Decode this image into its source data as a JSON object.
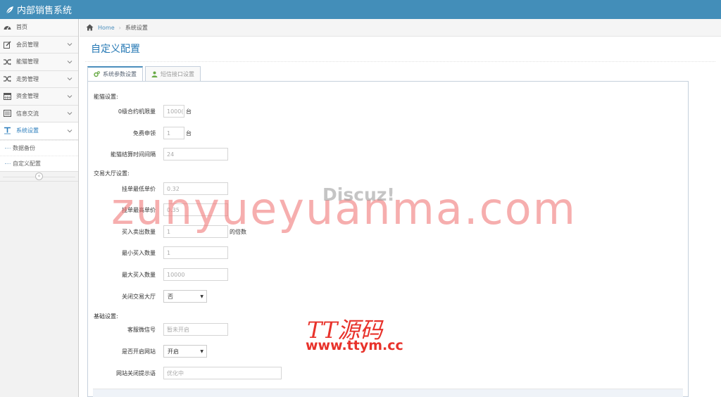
{
  "app": {
    "title": "内部销售系统"
  },
  "sidebar": {
    "items": [
      {
        "label": "首页",
        "icon": "tachometer-icon"
      },
      {
        "label": "会员管理",
        "icon": "edit-icon"
      },
      {
        "label": "能猫管理",
        "icon": "random-icon"
      },
      {
        "label": "走势管理",
        "icon": "random-icon"
      },
      {
        "label": "资金管理",
        "icon": "calendar-icon"
      },
      {
        "label": "信息交流",
        "icon": "list-icon"
      },
      {
        "label": "系统设置",
        "icon": "text-width-icon"
      }
    ],
    "sub_items": [
      {
        "label": "数据备份"
      },
      {
        "label": "自定义配置"
      }
    ],
    "collapse_symbol": "«"
  },
  "breadcrumb": {
    "home": "Home",
    "separator": "›",
    "current": "系统设置"
  },
  "page": {
    "title": "自定义配置"
  },
  "tabs": [
    {
      "label": "系统参数设置",
      "active": true
    },
    {
      "label": "短信接口设置",
      "active": false
    }
  ],
  "form": {
    "sections": [
      {
        "title": "能猫设置:",
        "fields": [
          {
            "label": "0级合约机限量",
            "value": "1000(",
            "suffix": "台"
          },
          {
            "label": "免费申领",
            "value": "1",
            "suffix": "台"
          },
          {
            "label": "能猫结算时间间隔",
            "value": "24",
            "suffix": ""
          }
        ]
      },
      {
        "title": "交易大厅设置:",
        "fields": [
          {
            "label": "挂单最低单价",
            "value": "0.32",
            "suffix": ""
          },
          {
            "label": "挂单最高单价",
            "value": "0.35",
            "suffix": ""
          },
          {
            "label": "买入卖出数量",
            "value": "1",
            "suffix": "的倍数"
          },
          {
            "label": "最小买入数量",
            "value": "1",
            "suffix": ""
          },
          {
            "label": "最大买入数量",
            "value": "10000",
            "suffix": ""
          },
          {
            "label": "关闭交易大厅",
            "value": "否",
            "suffix": ""
          }
        ]
      },
      {
        "title": "基础设置:",
        "fields": [
          {
            "label": "客服微信号",
            "value": "暂未开启",
            "suffix": ""
          },
          {
            "label": "是否开启网站",
            "value": "开启",
            "suffix": ""
          },
          {
            "label": "网站关闭提示语",
            "value": "优化中",
            "suffix": ""
          }
        ]
      }
    ]
  },
  "watermarks": {
    "main": "zunyueyuanma.com",
    "discuz": "Discuz!",
    "tt": "TT源码",
    "url": "www.ttym.cc"
  },
  "colors": {
    "navbar": "#438eb9",
    "accent": "#2679b5",
    "watermark_red": "#e8322b"
  }
}
